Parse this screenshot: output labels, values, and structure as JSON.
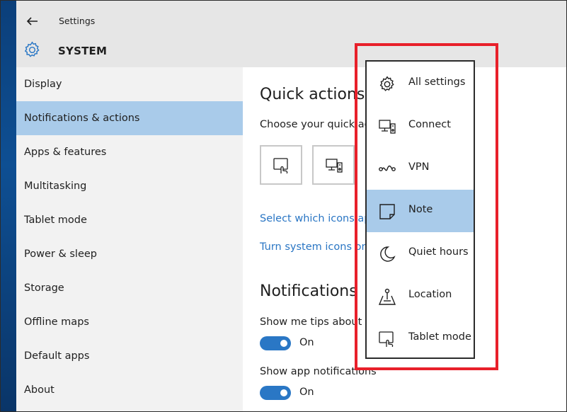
{
  "window": {
    "title": "Settings",
    "section": "SYSTEM"
  },
  "sidebar": {
    "items": [
      {
        "label": "Display"
      },
      {
        "label": "Notifications & actions",
        "active": true
      },
      {
        "label": "Apps & features"
      },
      {
        "label": "Multitasking"
      },
      {
        "label": "Tablet mode"
      },
      {
        "label": "Power & sleep"
      },
      {
        "label": "Storage"
      },
      {
        "label": "Offline maps"
      },
      {
        "label": "Default apps"
      },
      {
        "label": "About"
      }
    ]
  },
  "main": {
    "quick_actions_heading": "Quick actions",
    "quick_actions_desc": "Choose your quick act",
    "link_select_icons": "Select which icons app",
    "link_system_icons": "Turn system icons on o",
    "notifications_heading": "Notifications",
    "tips_label": "Show me tips about W",
    "tips_state": "On",
    "app_notif_label": "Show app notifications",
    "app_notif_state": "On"
  },
  "popup": {
    "items": [
      {
        "label": "All settings",
        "icon": "gear-icon"
      },
      {
        "label": "Connect",
        "icon": "connect-icon"
      },
      {
        "label": "VPN",
        "icon": "vpn-icon"
      },
      {
        "label": "Note",
        "icon": "note-icon",
        "selected": true
      },
      {
        "label": "Quiet hours",
        "icon": "moon-icon"
      },
      {
        "label": "Location",
        "icon": "location-icon"
      },
      {
        "label": "Tablet mode",
        "icon": "tablet-mode-icon"
      }
    ]
  },
  "colors": {
    "accent": "#2a77c5",
    "selection": "#a9cbea",
    "highlight_border": "#e8202a",
    "link": "#2a76c4"
  }
}
